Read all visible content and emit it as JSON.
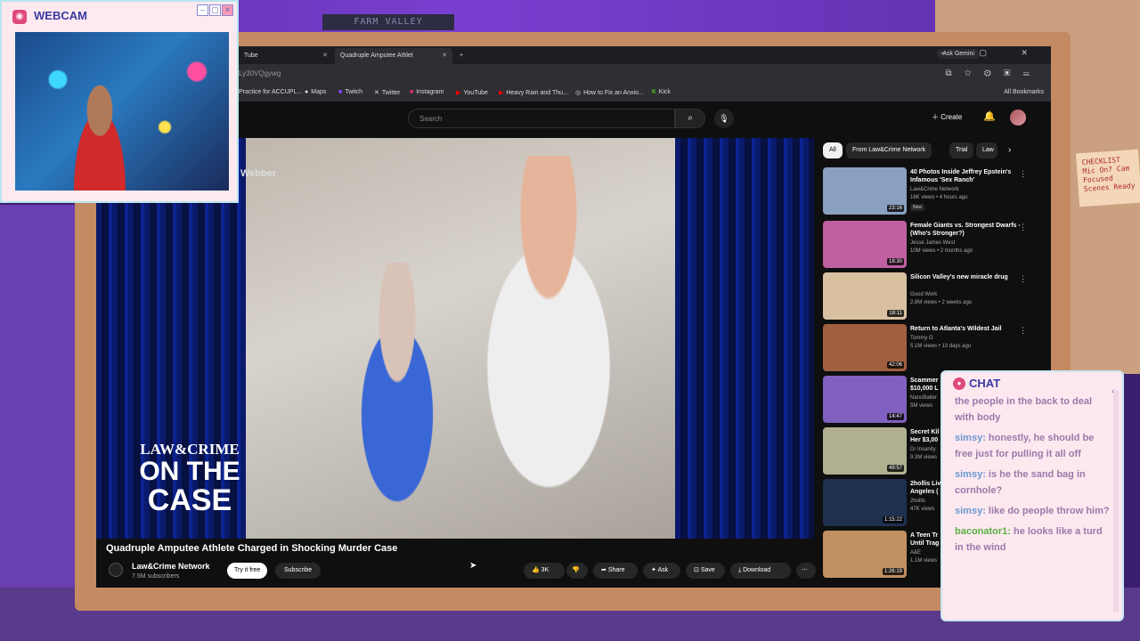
{
  "webcam": {
    "title": "WEBCAM"
  },
  "scene": {
    "shelf_label": "FARM VALLEY",
    "note": "CHECKLIST Mic On? Cam Focused Scenes Ready"
  },
  "browser": {
    "tabs": [
      {
        "label": "Tube"
      },
      {
        "label": "Quadruple Amputee Athlet"
      }
    ],
    "ask_gemini": "Ask Gemini",
    "url": "Ly30VQgywg",
    "bookmarks": [
      "Practice for ACCUPL...",
      "Maps",
      "Twitch",
      "Twitter",
      "Instagram",
      "YouTube",
      "Heavy Rain and Thu...",
      "How to Fix an Anxio...",
      "Kick"
    ],
    "all_bookmarks": "All Bookmarks"
  },
  "youtube": {
    "search_placeholder": "Search",
    "create": "Create",
    "video": {
      "overlay_name": "Webber",
      "brand_top": "LAW&CRIME",
      "brand_mid": "ON THE",
      "brand_bot": "CASE",
      "title": "Quadruple Amputee Athlete Charged in Shocking Murder Case",
      "channel": "Law&Crime Network",
      "subscribers": "7.5M subscribers",
      "try_free": "Try it free",
      "subscribe": "Subscribe",
      "likes": "3K",
      "share": "Share",
      "ask": "Ask",
      "save": "Save",
      "download": "Download"
    },
    "chips": [
      "All",
      "From Law&Crime Network",
      "Trial",
      "Law"
    ],
    "recommendations": [
      {
        "title": "40 Photos Inside Jeffrey Epstein's Infamous 'Sex Ranch'",
        "channel": "Law&Crime Network",
        "meta": "16K views • 4 hours ago",
        "badge": "New",
        "duration": "23:16",
        "thumb_color": "#8aa0c0"
      },
      {
        "title": "Female Giants vs. Strongest Dwarfs - (Who's Stronger?)",
        "channel": "Jesse James West",
        "meta": "10M views • 2 months ago",
        "badge": "",
        "duration": "18:30",
        "thumb_color": "#c060a0"
      },
      {
        "title": "Silicon Valley's new miracle drug",
        "channel": "Good Work",
        "meta": "2.8M views • 2 weeks ago",
        "badge": "",
        "duration": "18:11",
        "thumb_color": "#d8c0a0"
      },
      {
        "title": "Return to Atlanta's Wildest Jail",
        "channel": "Tommy G",
        "meta": "5.1M views • 13 days ago",
        "badge": "",
        "duration": "42:06",
        "thumb_color": "#a06040"
      },
      {
        "title": "Scammer $10,000 L",
        "channel": "NanoBaiter",
        "meta": "5M views",
        "badge": "",
        "duration": "14:47",
        "thumb_color": "#8060c0"
      },
      {
        "title": "Secret Kil Her $3,00",
        "channel": "Dr Insanity",
        "meta": "9.3M views",
        "badge": "",
        "duration": "49:57",
        "thumb_color": "#b0b090"
      },
      {
        "title": "2hollis Liv Angeles (",
        "channel": "2hollis",
        "meta": "47K views",
        "badge": "",
        "duration": "1:15:22",
        "thumb_color": "#203050"
      },
      {
        "title": "A Teen Tr Until Trag",
        "channel": "A&E",
        "meta": "1.1M views",
        "badge": "",
        "duration": "1:26:19",
        "thumb_color": "#c09060"
      }
    ]
  },
  "chat": {
    "title": "CHAT",
    "messages": [
      {
        "user": "",
        "text": "the people in the back to deal with body"
      },
      {
        "user": "simsy:",
        "text": "honestly, he should be free just for pulling it all off"
      },
      {
        "user": "simsy:",
        "text": "is he the sand bag in cornhole?"
      },
      {
        "user": "simsy:",
        "text": "like do people throw him?"
      },
      {
        "user": "baconator1:",
        "text": "he looks like a turd in the wind"
      }
    ]
  }
}
